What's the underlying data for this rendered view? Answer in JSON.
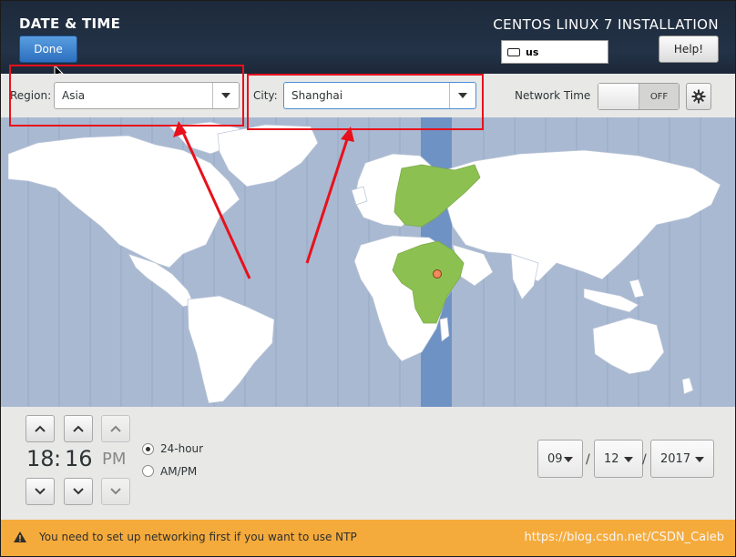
{
  "header": {
    "title": "DATE & TIME",
    "done_label": "Done",
    "install_title": "CENTOS LINUX 7 INSTALLATION",
    "keyboard_layout": "us",
    "help_label": "Help!"
  },
  "toolbar": {
    "region_label": "Region:",
    "region_value": "Asia",
    "city_label": "City:",
    "city_value": "Shanghai",
    "network_time_label": "Network Time",
    "network_time_state": "OFF"
  },
  "time": {
    "hours": "18",
    "separator": ":",
    "minutes": "16",
    "ampm": "PM",
    "format_24_label": "24-hour",
    "format_ampm_label": "AM/PM",
    "selected_format": "24-hour"
  },
  "date": {
    "month": "09",
    "day": "12",
    "year": "2017",
    "separator": "/"
  },
  "warning": {
    "text": "You need to set up networking first if you want to use NTP"
  },
  "watermark": "https://blog.csdn.net/CSDN_Caleb",
  "icons": [
    "keyboard-icon",
    "chevron-down-icon",
    "gear-icon",
    "chevron-up-icon",
    "warning-icon",
    "location-marker-icon",
    "mouse-cursor-icon"
  ],
  "colors": {
    "header_bg": "#1d2a3b",
    "accent_blue": "#2c6fbf",
    "map_ocean": "#a9b9d2",
    "timezone_band": "#6f92c5",
    "highlight_land": "#8cc152",
    "annotation_red": "#e8111b",
    "warning_bar": "#f5ab3b"
  }
}
